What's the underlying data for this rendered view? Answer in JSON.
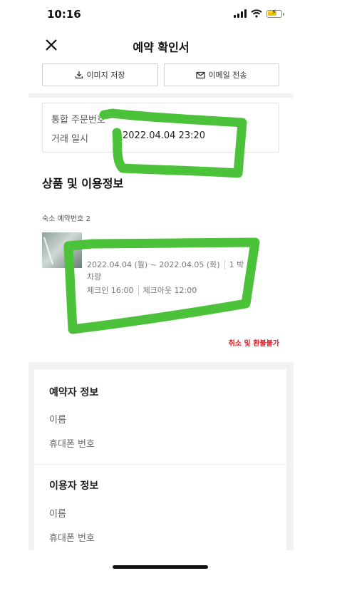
{
  "status_bar": {
    "time": "10:16"
  },
  "header": {
    "title": "예약 확인서",
    "close_icon": "close-icon",
    "save_image_label": "이미지 저장",
    "save_image_icon": "download-icon",
    "send_email_label": "이메일 전송",
    "send_email_icon": "mail-icon"
  },
  "order": {
    "order_number_label": "통합 주문번호",
    "transaction_label": "거래 일시",
    "transaction_value": "2022.04.04 23:20"
  },
  "product": {
    "section_title": "상품 및 이용정보",
    "stay_number_label": "숙소 예약번호 2",
    "dates": "2022.04.04 (월) ~ 2022.04.05 (화)",
    "nights": "1 박",
    "car": "차량",
    "check_in": "체크인 16:00",
    "check_out": "체크아웃 12:00",
    "refund_note": "취소 및 환불불가"
  },
  "booker": {
    "title": "예약자 정보",
    "name_label": "이름",
    "phone_label": "휴대폰 번호"
  },
  "user": {
    "title": "이용자 정보",
    "name_label": "이름",
    "phone_label": "휴대폰 번호"
  },
  "colors": {
    "redaction_green": "#4cc13a",
    "refund_red": "#e0202a",
    "battery_yellow": "#f5c400"
  }
}
